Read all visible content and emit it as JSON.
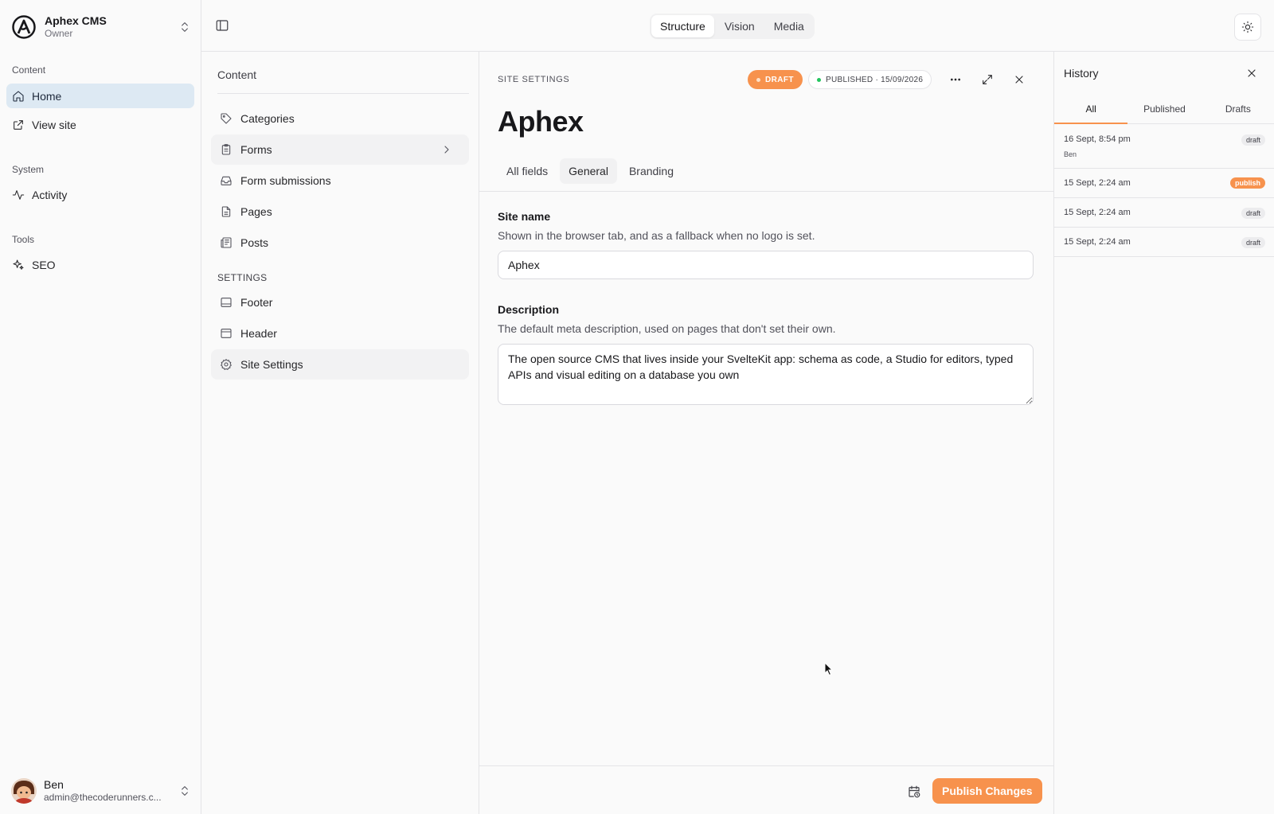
{
  "brand": {
    "name": "Aphex CMS",
    "role": "Owner"
  },
  "sidebar": {
    "groups": [
      {
        "label": "Content",
        "items": [
          {
            "label": "Home",
            "icon": "home-icon"
          },
          {
            "label": "View site",
            "icon": "external-link-icon"
          }
        ]
      },
      {
        "label": "System",
        "items": [
          {
            "label": "Activity",
            "icon": "activity-icon"
          }
        ]
      },
      {
        "label": "Tools",
        "items": [
          {
            "label": "SEO",
            "icon": "sparkles-icon"
          }
        ]
      }
    ]
  },
  "user": {
    "name": "Ben",
    "email": "admin@thecoderunners.c..."
  },
  "topbar": {
    "modes": [
      "Structure",
      "Vision",
      "Media"
    ],
    "active_mode": "Structure"
  },
  "structure": {
    "title": "Content",
    "items": [
      {
        "label": "Categories",
        "icon": "tag-icon"
      },
      {
        "label": "Forms",
        "icon": "clipboard-icon"
      },
      {
        "label": "Form submissions",
        "icon": "inbox-icon"
      },
      {
        "label": "Pages",
        "icon": "file-text-icon"
      },
      {
        "label": "Posts",
        "icon": "newspaper-icon"
      }
    ],
    "settings_label": "SETTINGS",
    "settings_items": [
      {
        "label": "Footer",
        "icon": "panel-bottom-icon"
      },
      {
        "label": "Header",
        "icon": "panel-top-icon"
      },
      {
        "label": "Site Settings",
        "icon": "gear-icon"
      }
    ]
  },
  "document": {
    "type_label": "SITE SETTINGS",
    "draft_badge": "DRAFT",
    "published_badge": "PUBLISHED · 15/09/2026",
    "title": "Aphex",
    "tabs": [
      "All fields",
      "General",
      "Branding"
    ],
    "active_tab": "General",
    "fields": {
      "site_name": {
        "label": "Site name",
        "help": "Shown in the browser tab, and as a fallback when no logo is set.",
        "value": "Aphex"
      },
      "description": {
        "label": "Description",
        "help": "The default meta description, used on pages that don't set their own.",
        "value": "The open source CMS that lives inside your SvelteKit app: schema as code, a Studio for editors, typed APIs and visual editing on a database you own"
      }
    },
    "publish_label": "Publish Changes"
  },
  "history": {
    "title": "History",
    "tabs": [
      "All",
      "Published",
      "Drafts"
    ],
    "active_tab": "All",
    "entries": [
      {
        "time": "16 Sept, 8:54 pm",
        "author": "Ben",
        "status": "draft"
      },
      {
        "time": "15 Sept, 2:24 am",
        "status": "publish"
      },
      {
        "time": "15 Sept, 2:24 am",
        "status": "draft"
      },
      {
        "time": "15 Sept, 2:24 am",
        "status": "draft"
      }
    ]
  },
  "colors": {
    "accent": "#f7924d",
    "active_nav": "#dde9f3",
    "published_dot": "#22c55e"
  }
}
